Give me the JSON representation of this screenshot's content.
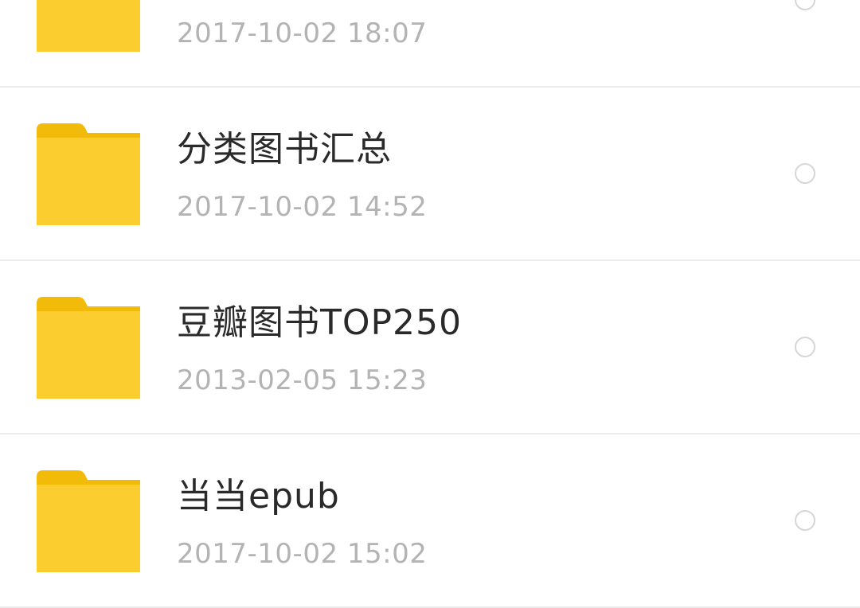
{
  "files": {
    "items": [
      {
        "name": "",
        "date": "2017-10-02  18:07",
        "icon": "folder-icon"
      },
      {
        "name": "分类图书汇总",
        "date": "2017-10-02  14:52",
        "icon": "folder-icon"
      },
      {
        "name": "豆瓣图书TOP250",
        "date": "2013-02-05  15:23",
        "icon": "folder-icon"
      },
      {
        "name": "当当epub",
        "date": "2017-10-02  15:02",
        "icon": "folder-icon"
      }
    ]
  },
  "colors": {
    "folder_body": "#fccd2f",
    "folder_tab": "#f2bb0a",
    "text_primary": "#2a2a2a",
    "text_secondary": "#b3b3b3",
    "divider": "#ececec",
    "radio_border": "#d6d6d6"
  }
}
